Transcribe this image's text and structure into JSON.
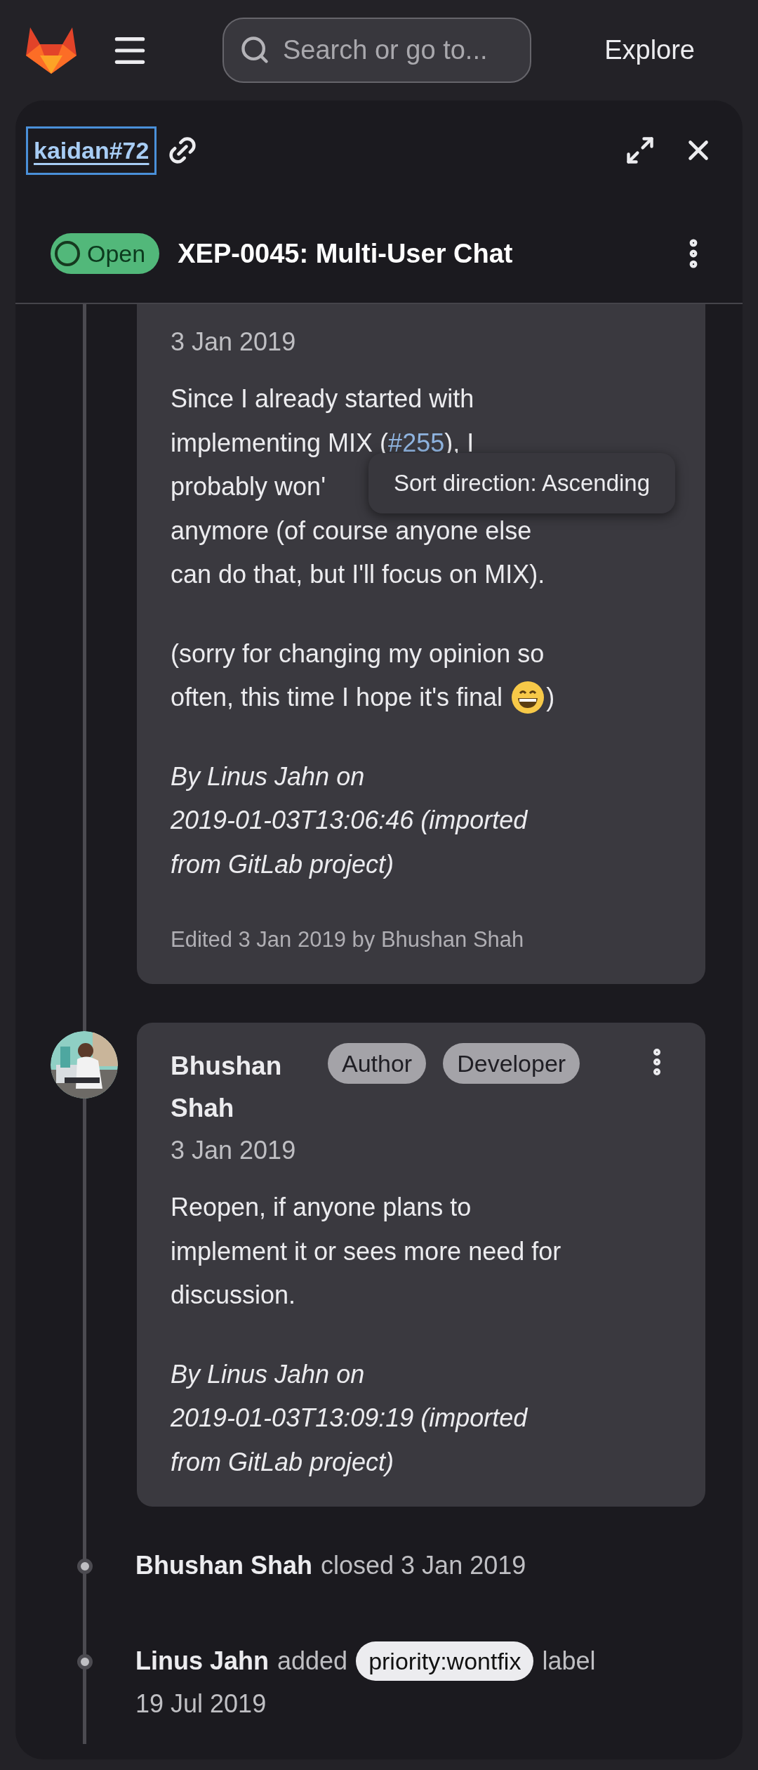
{
  "topbar": {
    "search": {
      "placeholder": "Search or go to..."
    },
    "explore": "Explore"
  },
  "drawer": {
    "reference": "kaidan#72",
    "reference_focused": true,
    "status": "Open",
    "title": "XEP-0045: Multi-User Chat"
  },
  "tooltip": "Sort direction: Ascending",
  "notes": [
    {
      "kind": "comment",
      "date": "3 Jan 2019",
      "paragraphs": [
        {
          "kind": "text",
          "lines": [
            "Since I already started with",
            [
              {
                "kind": "text",
                "text": "implementing MIX ("
              },
              {
                "kind": "link",
                "text": "#255"
              },
              {
                "kind": "text",
                "text": "), I"
              }
            ],
            "probably won'",
            "anymore (of course anyone else",
            "can do that, but I'll focus on MIX)."
          ]
        },
        {
          "kind": "text",
          "lines": [
            "(sorry for changing my opinion so",
            [
              {
                "kind": "text",
                "text": "often, this time I hope it's final "
              },
              {
                "kind": "emoji"
              },
              {
                "kind": "text",
                "text": ")"
              }
            ]
          ]
        },
        {
          "kind": "signature",
          "lines": [
            "By Linus Jahn on",
            "2019-01-03T13:06:46 (imported",
            "from GitLab project)"
          ]
        }
      ],
      "edited": "Edited 3 Jan 2019 by Bhushan Shah"
    },
    {
      "kind": "comment",
      "author": "Bhushan Shah",
      "badges": [
        "Author",
        "Developer"
      ],
      "date": "3 Jan 2019",
      "paragraphs": [
        {
          "kind": "text",
          "lines": [
            "Reopen, if anyone plans to",
            "implement it or sees more need for",
            "discussion."
          ]
        },
        {
          "kind": "signature",
          "lines": [
            "By Linus Jahn on",
            "2019-01-03T13:09:19 (imported",
            "from GitLab project)"
          ]
        }
      ]
    },
    {
      "kind": "event",
      "actor": "Bhushan Shah",
      "action": "closed 3 Jan 2019"
    },
    {
      "kind": "event",
      "actor": "Linus Jahn",
      "action": "added",
      "label": "priority:wontfix",
      "suffix": "label",
      "date": "19 Jul 2019"
    }
  ]
}
